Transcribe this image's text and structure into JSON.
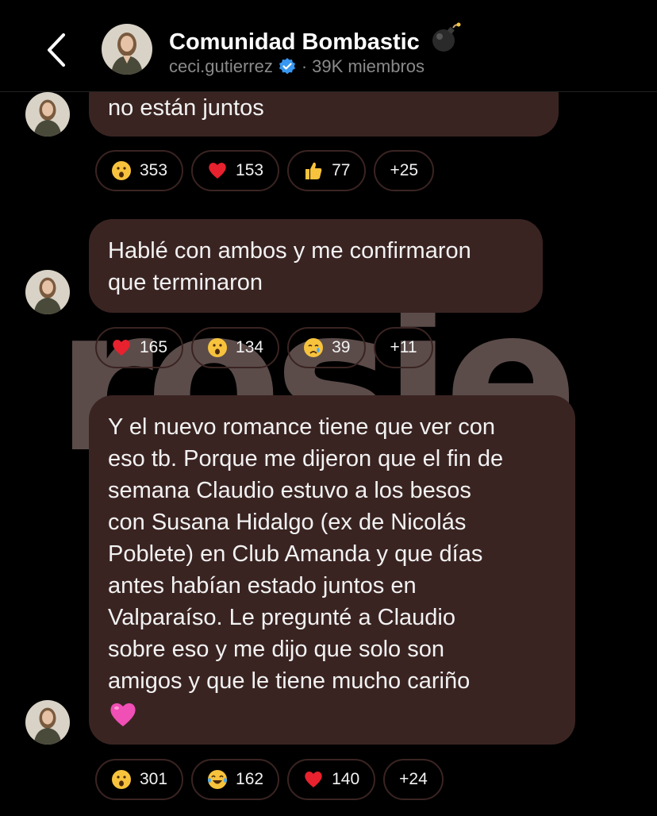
{
  "header": {
    "title": "Comunidad Bombastic",
    "title_icon": "bomb-icon",
    "username": "ceci.gutierrez",
    "separator": "·",
    "members": "39K miembros",
    "back_icon": "chevron-left-icon"
  },
  "watermark": "rosie",
  "messages": [
    {
      "text": "no están juntos",
      "reactions": [
        {
          "icon": "surprised-face-icon",
          "count": "353"
        },
        {
          "icon": "red-heart-icon",
          "count": "153"
        },
        {
          "icon": "thumbs-up-icon",
          "count": "77"
        },
        {
          "more": "+25"
        }
      ]
    },
    {
      "text": "Hablé con ambos y me confirmaron\nque terminaron",
      "reactions": [
        {
          "icon": "red-heart-icon",
          "count": "165"
        },
        {
          "icon": "surprised-face-icon",
          "count": "134"
        },
        {
          "icon": "crying-face-icon",
          "count": "39"
        },
        {
          "more": "+11"
        }
      ]
    },
    {
      "text": "Y el nuevo romance tiene que ver con\neso tb. Porque me dijeron que el fin de\nsemana Claudio estuvo a los besos\ncon Susana Hidalgo (ex de Nicolás\nPoblete) en Club Amanda y que días\nantes habían estado juntos en\nValparaíso. Le pregunté a Claudio\nsobre eso y me dijo que solo son\namigos y que le tiene mucho cariño",
      "trailing_emoji": "pink-heart-icon",
      "reactions": [
        {
          "icon": "surprised-face-icon",
          "count": "301"
        },
        {
          "icon": "tears-of-joy-icon",
          "count": "162"
        },
        {
          "icon": "red-heart-icon",
          "count": "140"
        },
        {
          "more": "+24"
        }
      ]
    }
  ],
  "colors": {
    "bubble": "#3a2422",
    "background": "#000000",
    "verified": "#3897f0",
    "muted_text": "#8a8a8a"
  }
}
